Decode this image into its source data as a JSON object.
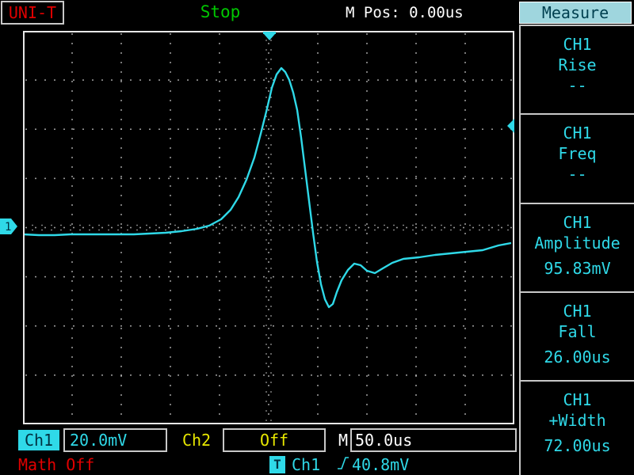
{
  "header": {
    "brand": "UNI-T",
    "run_status": "Stop",
    "m_pos": "M Pos: 0.00us"
  },
  "menu": {
    "title": "Measure",
    "panels": [
      {
        "source": "CH1",
        "name": "Rise",
        "value": "--"
      },
      {
        "source": "CH1",
        "name": "Freq",
        "value": "--"
      },
      {
        "source": "CH1",
        "name": "Amplitude",
        "value": "95.83mV"
      },
      {
        "source": "CH1",
        "name": "Fall",
        "value": "26.00us"
      },
      {
        "source": "CH1",
        "name": "+Width",
        "value": "72.00us"
      }
    ]
  },
  "status": {
    "ch1_label": "Ch1",
    "ch1_scale": "20.0mV",
    "ch2_label": "Ch2",
    "ch2_scale": "Off",
    "m_label": "M",
    "time_scale": "50.0us",
    "math": "Math Off",
    "trigger_icon": "T",
    "trigger_source": "Ch1",
    "trigger_slope_icon": "rising-edge-icon",
    "trigger_level": "40.8mV"
  },
  "markers": {
    "ch1_ground": "1"
  },
  "colors": {
    "trace": "#2fd9e8",
    "ch2": "#e8e800",
    "status_green": "#00c800",
    "brand_red": "#e00000"
  }
}
